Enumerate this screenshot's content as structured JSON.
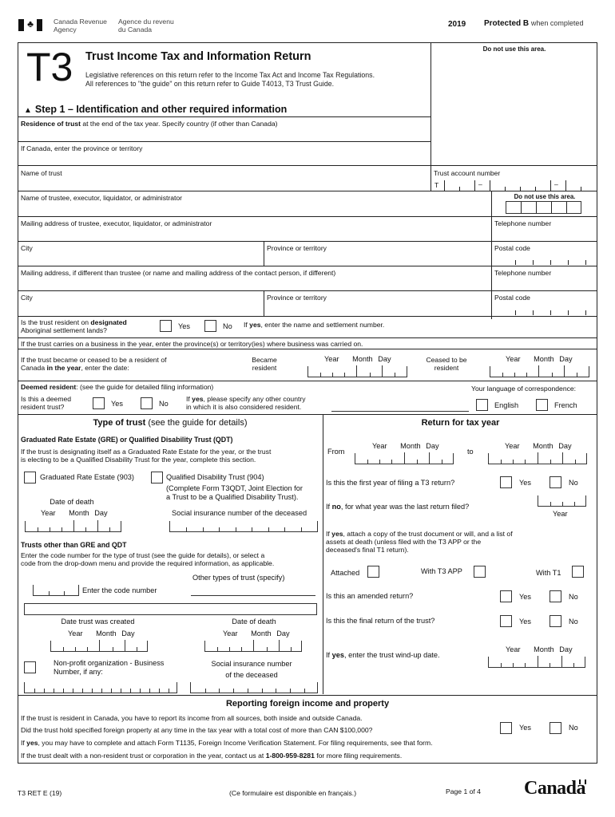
{
  "header": {
    "agency_en_line1": "Canada Revenue",
    "agency_en_line2": "Agency",
    "agency_fr_line1": "Agence du revenu",
    "agency_fr_line2": "du Canada",
    "year": "2019",
    "protected_label": "Protected B",
    "protected_suffix": "when completed"
  },
  "title_block": {
    "form_code": "T3",
    "title": "Trust Income Tax and Information Return",
    "legislative_line1": "Legislative references on this return refer to the Income Tax Act and Income Tax Regulations.",
    "legislative_line2": "All references to \"the guide\" on this return refer to Guide T4013, T3 Trust Guide.",
    "do_not_use": "Do not use this area.",
    "step_marker": "▲",
    "step_title": "Step 1 – Identification and other required information"
  },
  "identification": {
    "residence_bold": "Residence of trust",
    "residence_rest": "at the end of the tax year. Specify country (if other than Canada)",
    "province_label": "If Canada, enter the province or territory",
    "name_of_trust": "Name of trust",
    "trust_account_number": "Trust account number",
    "trust_account_prefix": "T",
    "dash": "–",
    "trustee_name": "Name of trustee, executor, liquidator, or administrator",
    "do_not_use_small": "Do not use this area.",
    "trustee_mailing": "Mailing address of trustee, executor, liquidator, or administrator",
    "telephone": "Telephone number",
    "city": "City",
    "province_or_territory": "Province or territory",
    "postal_code": "Postal code",
    "alt_mailing": "Mailing address, if different than trustee (or name and mailing address of the contact person, if different)",
    "telephone2": "Telephone number",
    "city2": "City",
    "province_or_territory2": "Province or territory",
    "postal_code2": "Postal code",
    "aboriginal_q_line1_pre": "Is the trust resident on ",
    "aboriginal_q_line1_bold": "designated",
    "aboriginal_q_line2": "Aboriginal settlement lands?",
    "yes": "Yes",
    "no": "No",
    "aboriginal_followup_bold": "yes",
    "aboriginal_followup_pre": "If ",
    "aboriginal_followup_rest": ", enter the name and settlement number.",
    "business_label": "If the trust carries on a business in the year, enter the province(s) or territory(ies) where business was carried on.",
    "became_ceased_line1": "If the trust became or ceased to be a resident of",
    "became_ceased_line2_pre": "Canada ",
    "became_ceased_line2_bold": "in the year",
    "became_ceased_line2_post": ", enter the date:",
    "became_resident_line1": "Became",
    "became_resident_line2": "resident",
    "ceased_line1": "Ceased to be",
    "ceased_line2": "resident",
    "year": "Year",
    "month": "Month",
    "day": "Day",
    "deemed_bold": "Deemed resident",
    "deemed_rest": ": (see the guide for detailed filing information)",
    "deemed_q_line1": "Is this a deemed",
    "deemed_q_line2": "resident trust?",
    "deemed_followup_line1_pre": "If ",
    "deemed_followup_line1_bold": "yes",
    "deemed_followup_line1_post": ", please specify any other country",
    "deemed_followup_line2": "in which it is also considered resident.",
    "language_label": "Your language of correspondence:",
    "english": "English",
    "french": "French"
  },
  "type_of_trust": {
    "heading_bold": "Type of trust",
    "heading_rest": " (see the guide for details)",
    "gre_qdt_heading": "Graduated Rate Estate (GRE) or Qualified Disability Trust (QDT)",
    "gre_qdt_desc_line1": "If the trust is designating itself as a Graduated Rate Estate for the year, or the trust",
    "gre_qdt_desc_line2": "is electing to be a Qualified Disability Trust for the year, complete this section.",
    "gre_option": "Graduated Rate Estate (903)",
    "qdt_option": "Qualified Disability Trust (904)",
    "qdt_note_line1": "(Complete Form T3QDT, Joint Election for",
    "qdt_note_line2": "a Trust to be a Qualified Disability Trust).",
    "date_of_death": "Date of death",
    "sin_deceased": "Social insurance number of the deceased",
    "other_heading": "Trusts other than GRE and QDT",
    "other_desc_line1": "Enter the code number for the type of trust (see the guide for details), or select a",
    "other_desc_line2": "code from the drop-down menu and provide the required information, as applicable.",
    "other_types_label": "Other types of trust (specify)",
    "enter_code": "Enter the code number",
    "date_created": "Date trust was created",
    "date_of_death2": "Date of death",
    "nonprofit_line1": "Non-profit organization - Business",
    "nonprofit_line2": "Number, if any:",
    "sin_line1": "Social insurance number",
    "sin_line2": "of the deceased"
  },
  "return_for_tax_year": {
    "heading": "Return for tax year",
    "from": "From",
    "to": "to",
    "first_year_q": "Is this the first year of filing a T3 return?",
    "last_filed_pre": "If ",
    "last_filed_bold": "no",
    "last_filed_post": ", for what year was the last return filed?",
    "year_caption": "Year",
    "attach_line1_pre": "If ",
    "attach_line1_bold": "yes",
    "attach_line1_post": ", attach a copy of the trust document or will, and a list of",
    "attach_line2": "assets at death (unless filed with the T3 APP or the",
    "attach_line3": "deceased's final T1 return).",
    "attached": "Attached",
    "with_t3app": "With T3 APP",
    "with_t1": "With T1",
    "amended_q": "Is this an amended return?",
    "final_q": "Is this the final return of the trust?",
    "windup_pre": "If ",
    "windup_bold": "yes",
    "windup_post": ", enter the trust wind-up date."
  },
  "foreign": {
    "heading": "Reporting foreign income and property",
    "line1": "If the trust is resident in Canada, you have to report its income from all sources, both inside and outside Canada.",
    "line2": "Did the trust hold specified foreign property at any time in the tax year with a total cost of more than CAN $100,000?",
    "line3_pre": "If ",
    "line3_bold": "yes",
    "line3_post": ", you may have to complete and attach Form T1135, Foreign Income Verification Statement. For filing requirements, see that form.",
    "line4_pre": "If the trust dealt with a non-resident trust or corporation in the year, contact us at ",
    "line4_bold": "1-800-959-8281",
    "line4_post": " for more filing requirements."
  },
  "footer": {
    "form_id": "T3 RET E (19)",
    "french_note": "(Ce formulaire est disponible en français.)",
    "page": "Page 1 of 4",
    "wordmark": "Canada"
  }
}
